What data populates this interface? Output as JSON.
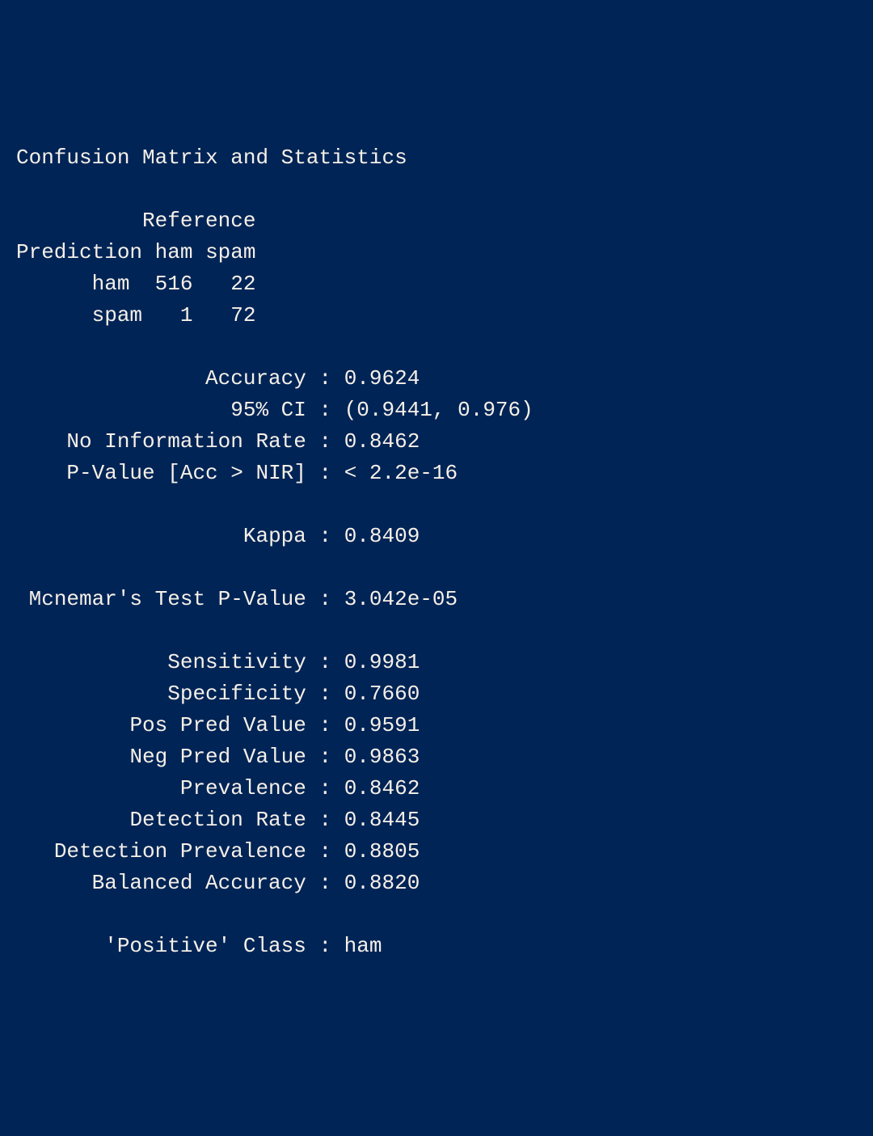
{
  "title": "Confusion Matrix and Statistics",
  "matrix": {
    "reference_label": "Reference",
    "prediction_label": "Prediction",
    "col1_label": "ham",
    "col2_label": "spam",
    "row1_label": "ham",
    "row2_label": "spam",
    "r1c1": "516",
    "r1c2": "22",
    "r2c1": "1",
    "r2c2": "72"
  },
  "stats": {
    "accuracy_label": "Accuracy",
    "accuracy_value": "0.9624",
    "ci_label": "95% CI",
    "ci_value": "(0.9441, 0.976)",
    "nir_label": "No Information Rate",
    "nir_value": "0.8462",
    "pvalue_label": "P-Value [Acc > NIR]",
    "pvalue_value": "< 2.2e-16",
    "kappa_label": "Kappa",
    "kappa_value": "0.8409",
    "mcnemar_label": "Mcnemar's Test P-Value",
    "mcnemar_value": "3.042e-05",
    "sensitivity_label": "Sensitivity",
    "sensitivity_value": "0.9981",
    "specificity_label": "Specificity",
    "specificity_value": "0.7660",
    "ppv_label": "Pos Pred Value",
    "ppv_value": "0.9591",
    "npv_label": "Neg Pred Value",
    "npv_value": "0.9863",
    "prevalence_label": "Prevalence",
    "prevalence_value": "0.8462",
    "detection_rate_label": "Detection Rate",
    "detection_rate_value": "0.8445",
    "detection_prevalence_label": "Detection Prevalence",
    "detection_prevalence_value": "0.8805",
    "balanced_accuracy_label": "Balanced Accuracy",
    "balanced_accuracy_value": "0.8820",
    "positive_class_label": "'Positive' Class",
    "positive_class_value": "ham"
  }
}
